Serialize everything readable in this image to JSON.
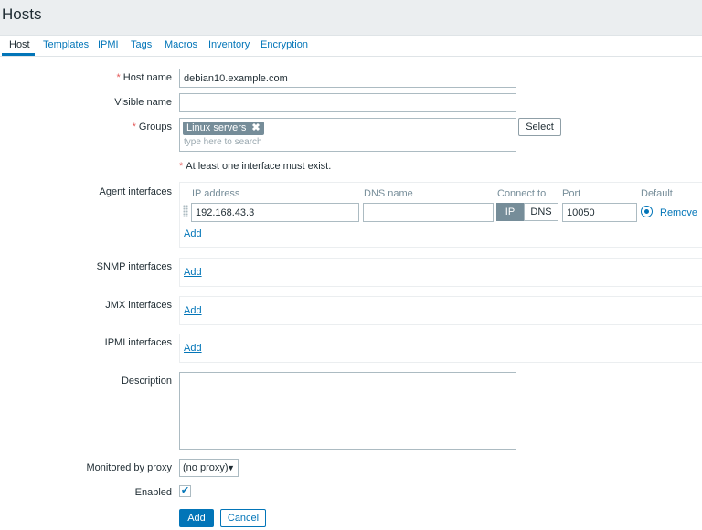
{
  "page": {
    "title": "Hosts"
  },
  "tabs": [
    {
      "label": "Host",
      "active": true
    },
    {
      "label": "Templates"
    },
    {
      "label": "IPMI"
    },
    {
      "label": "Tags"
    },
    {
      "label": "Macros"
    },
    {
      "label": "Inventory"
    },
    {
      "label": "Encryption"
    }
  ],
  "form": {
    "required_marker": "*",
    "host_name": {
      "label": "Host name",
      "value": "debian10.example.com"
    },
    "visible_name": {
      "label": "Visible name",
      "value": ""
    },
    "groups": {
      "label": "Groups",
      "selected": "Linux servers",
      "remove_glyph": "✖",
      "placeholder": "type here to search",
      "select_button": "Select"
    },
    "interface_hint": "At least one interface must exist.",
    "agent_interfaces": {
      "label": "Agent interfaces",
      "columns": {
        "ip": "IP address",
        "dns": "DNS name",
        "connect": "Connect to",
        "port": "Port",
        "default": "Default"
      },
      "row": {
        "ip": "192.168.43.3",
        "dns": "",
        "connect_ip": "IP",
        "connect_dns": "DNS",
        "port": "10050",
        "remove": "Remove"
      },
      "add": "Add"
    },
    "snmp_interfaces": {
      "label": "SNMP interfaces",
      "add": "Add"
    },
    "jmx_interfaces": {
      "label": "JMX interfaces",
      "add": "Add"
    },
    "ipmi_interfaces": {
      "label": "IPMI interfaces",
      "add": "Add"
    },
    "description": {
      "label": "Description",
      "value": ""
    },
    "proxy": {
      "label": "Monitored by proxy",
      "value": "(no proxy)"
    },
    "enabled": {
      "label": "Enabled",
      "checked": true,
      "check_glyph": "✔"
    },
    "buttons": {
      "add": "Add",
      "cancel": "Cancel"
    }
  },
  "colors": {
    "accent": "#0275b8",
    "required": "#e45959",
    "chip": "#768d99",
    "header_bg": "#ebeef0"
  }
}
